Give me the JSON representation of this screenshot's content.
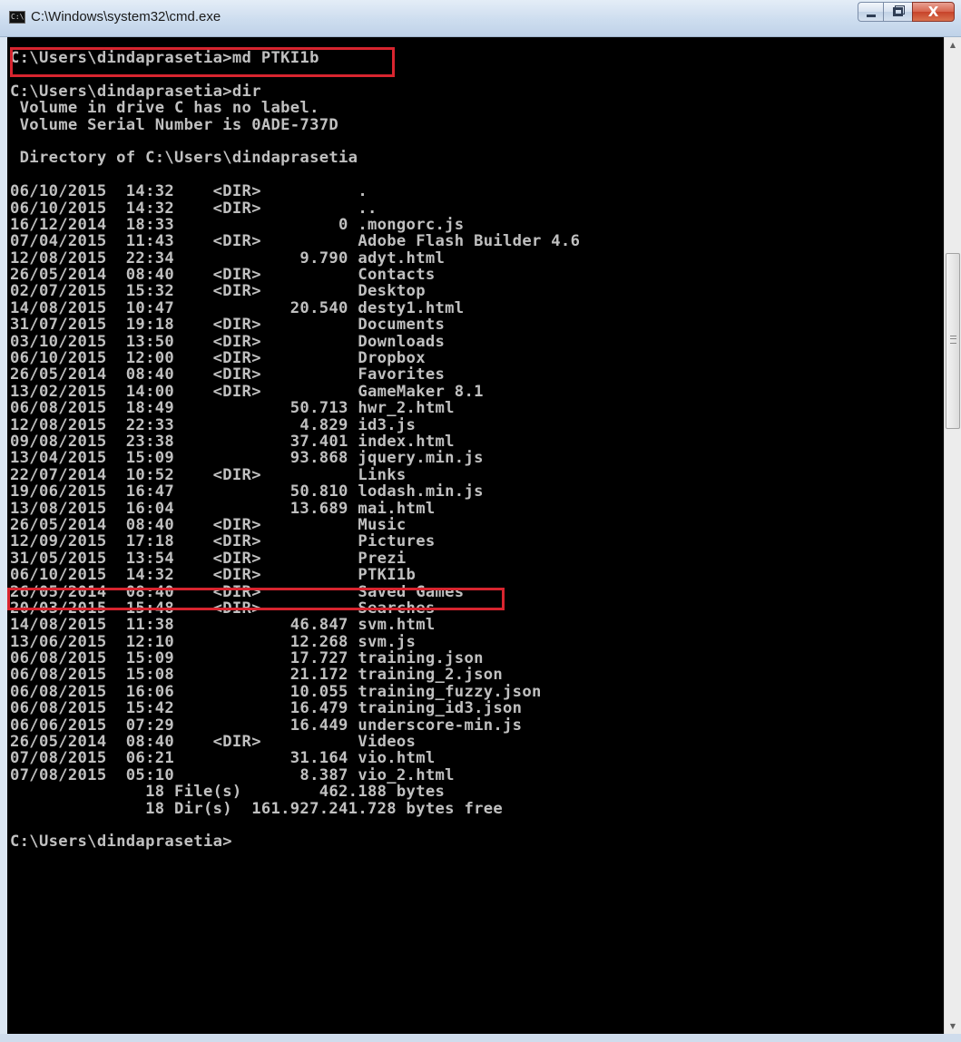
{
  "window": {
    "title": "C:\\Windows\\system32\\cmd.exe",
    "icon_text": "C:\\",
    "close_glyph": "X"
  },
  "scrollbar": {
    "up_glyph": "▲",
    "down_glyph": "▼"
  },
  "console_lines": [
    "C:\\Users\\dindaprasetia>md PTKI1b",
    "",
    "C:\\Users\\dindaprasetia>dir",
    " Volume in drive C has no label.",
    " Volume Serial Number is 0ADE-737D",
    "",
    " Directory of C:\\Users\\dindaprasetia",
    "",
    "06/10/2015  14:32    <DIR>          .",
    "06/10/2015  14:32    <DIR>          ..",
    "16/12/2014  18:33                 0 .mongorc.js",
    "07/04/2015  11:43    <DIR>          Adobe Flash Builder 4.6",
    "12/08/2015  22:34             9.790 adyt.html",
    "26/05/2014  08:40    <DIR>          Contacts",
    "02/07/2015  15:32    <DIR>          Desktop",
    "14/08/2015  10:47            20.540 desty1.html",
    "31/07/2015  19:18    <DIR>          Documents",
    "03/10/2015  13:50    <DIR>          Downloads",
    "06/10/2015  12:00    <DIR>          Dropbox",
    "26/05/2014  08:40    <DIR>          Favorites",
    "13/02/2015  14:00    <DIR>          GameMaker 8.1",
    "06/08/2015  18:49            50.713 hwr_2.html",
    "12/08/2015  22:33             4.829 id3.js",
    "09/08/2015  23:38            37.401 index.html",
    "13/04/2015  15:09            93.868 jquery.min.js",
    "22/07/2014  10:52    <DIR>          Links",
    "19/06/2015  16:47            50.810 lodash.min.js",
    "13/08/2015  16:04            13.689 mai.html",
    "26/05/2014  08:40    <DIR>          Music",
    "12/09/2015  17:18    <DIR>          Pictures",
    "31/05/2015  13:54    <DIR>          Prezi",
    "06/10/2015  14:32    <DIR>          PTKI1b",
    "26/05/2014  08:40    <DIR>          Saved Games",
    "20/03/2015  15:48    <DIR>          Searches",
    "14/08/2015  11:38            46.847 svm.html",
    "13/06/2015  12:10            12.268 svm.js",
    "06/08/2015  15:09            17.727 training.json",
    "06/08/2015  15:08            21.172 training_2.json",
    "06/08/2015  16:06            10.055 training_fuzzy.json",
    "06/08/2015  15:42            16.479 training_id3.json",
    "06/06/2015  07:29            16.449 underscore-min.js",
    "26/05/2014  08:40    <DIR>          Videos",
    "07/08/2015  06:21            31.164 vio.html",
    "07/08/2015  05:10             8.387 vio_2.html",
    "              18 File(s)        462.188 bytes",
    "              18 Dir(s)  161.927.241.728 bytes free",
    "",
    "C:\\Users\\dindaprasetia>"
  ]
}
